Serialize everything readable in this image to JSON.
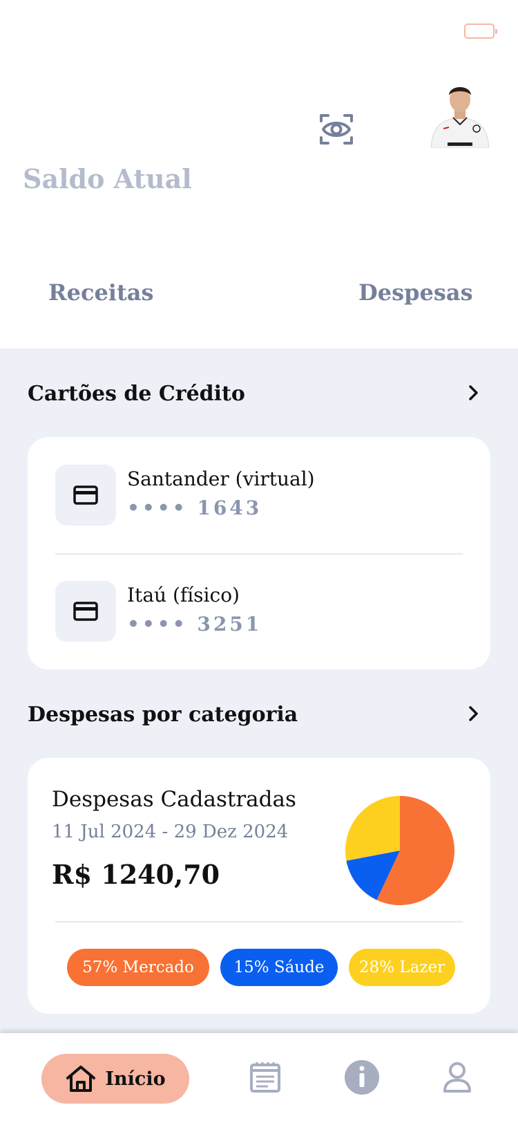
{
  "header": {
    "balance_label": "Saldo Atual",
    "tabs": [
      {
        "label": "Receitas"
      },
      {
        "label": "Despesas"
      }
    ]
  },
  "credit_cards": {
    "title": "Cartões  de Crédito",
    "cards": [
      {
        "name": "Santander (virtual)",
        "masked_number": "•••• 1643",
        "icon": "credit-card-icon"
      },
      {
        "name": "Itaú (físico)",
        "masked_number": "•••• 3251",
        "icon": "credit-card-icon"
      }
    ]
  },
  "expenses": {
    "title": "Despesas por categoria",
    "card_title": "Despesas Cadastradas",
    "date_range": "11 Jul 2024 - 29 Dez 2024",
    "total": "R$ 1240,70",
    "categories": [
      {
        "label": "57% Mercado",
        "percent": 57,
        "color": "#f77234"
      },
      {
        "label": "15% Sáude",
        "percent": 15,
        "color": "#0a5ef0"
      },
      {
        "label": "28% Lazer",
        "percent": 28,
        "color": "#fdd01f"
      }
    ]
  },
  "nav": {
    "items": [
      {
        "label": "Início",
        "icon": "home-icon",
        "active": true
      },
      {
        "label": "",
        "icon": "calendar-list-icon"
      },
      {
        "label": "",
        "icon": "info-icon"
      },
      {
        "label": "",
        "icon": "user-icon"
      }
    ]
  },
  "colors": {
    "accent": "#f6b6a2",
    "background": "#edf0f7",
    "muted_text": "#75809a"
  }
}
